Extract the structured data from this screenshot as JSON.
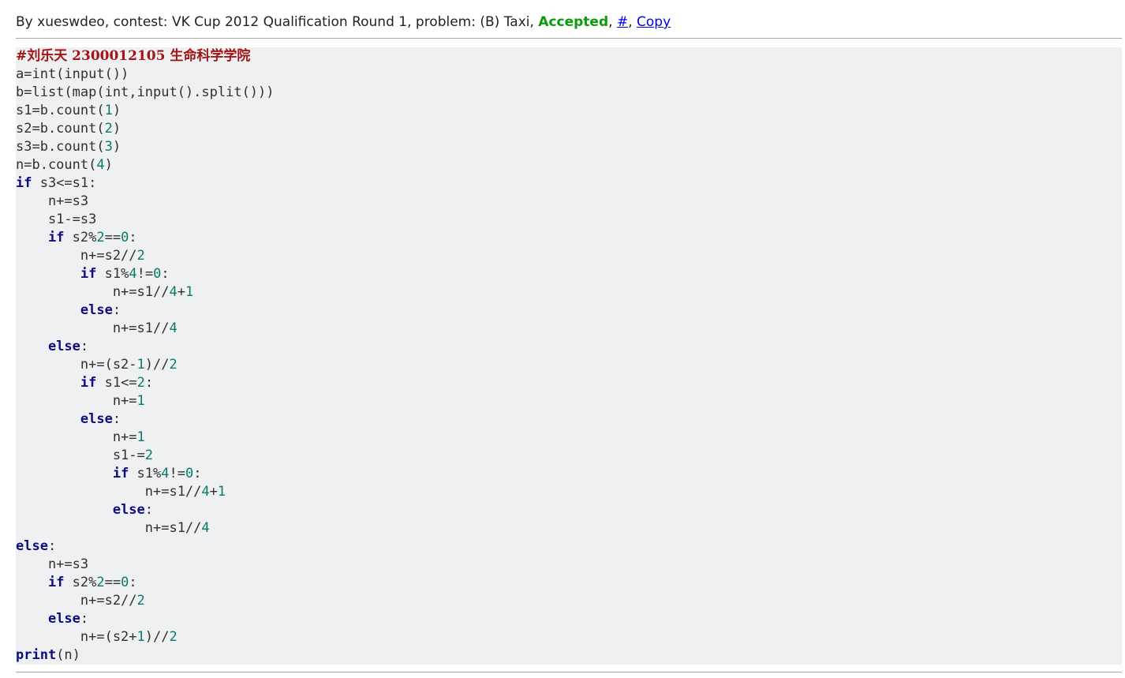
{
  "header": {
    "prefix": "By xueswdeo, contest: VK Cup 2012 Qualification Round 1, problem: (B) Taxi, ",
    "verdict": "Accepted",
    "sep1": ", ",
    "hash_link": "#",
    "sep2": ", ",
    "copy_link": "Copy"
  },
  "code": {
    "language": "python",
    "lines": [
      "#刘乐天 2300012105 生命科学学院",
      "a=int(input())",
      "b=list(map(int,input().split()))",
      "s1=b.count(1)",
      "s2=b.count(2)",
      "s3=b.count(3)",
      "n=b.count(4)",
      "if s3<=s1:",
      "    n+=s3",
      "    s1-=s3",
      "    if s2%2==0:",
      "        n+=s2//2",
      "        if s1%4!=0:",
      "            n+=s1//4+1",
      "        else:",
      "            n+=s1//4",
      "    else:",
      "        n+=(s2-1)//2",
      "        if s1<=2:",
      "            n+=1",
      "        else:",
      "            n+=1",
      "            s1-=2",
      "            if s1%4!=0:",
      "                n+=s1//4+1",
      "            else:",
      "                n+=s1//4",
      "else:",
      "    n+=s3",
      "    if s2%2==0:",
      "        n+=s2//2",
      "    else:",
      "        n+=(s2+1)//2",
      "print(n)"
    ]
  },
  "colors": {
    "accepted": "#0a9a0a",
    "link": "#0000ee",
    "code_background": "#eff0f1",
    "keyword": "#0d0d80",
    "comment": "#a31515",
    "number": "#097a6a"
  }
}
